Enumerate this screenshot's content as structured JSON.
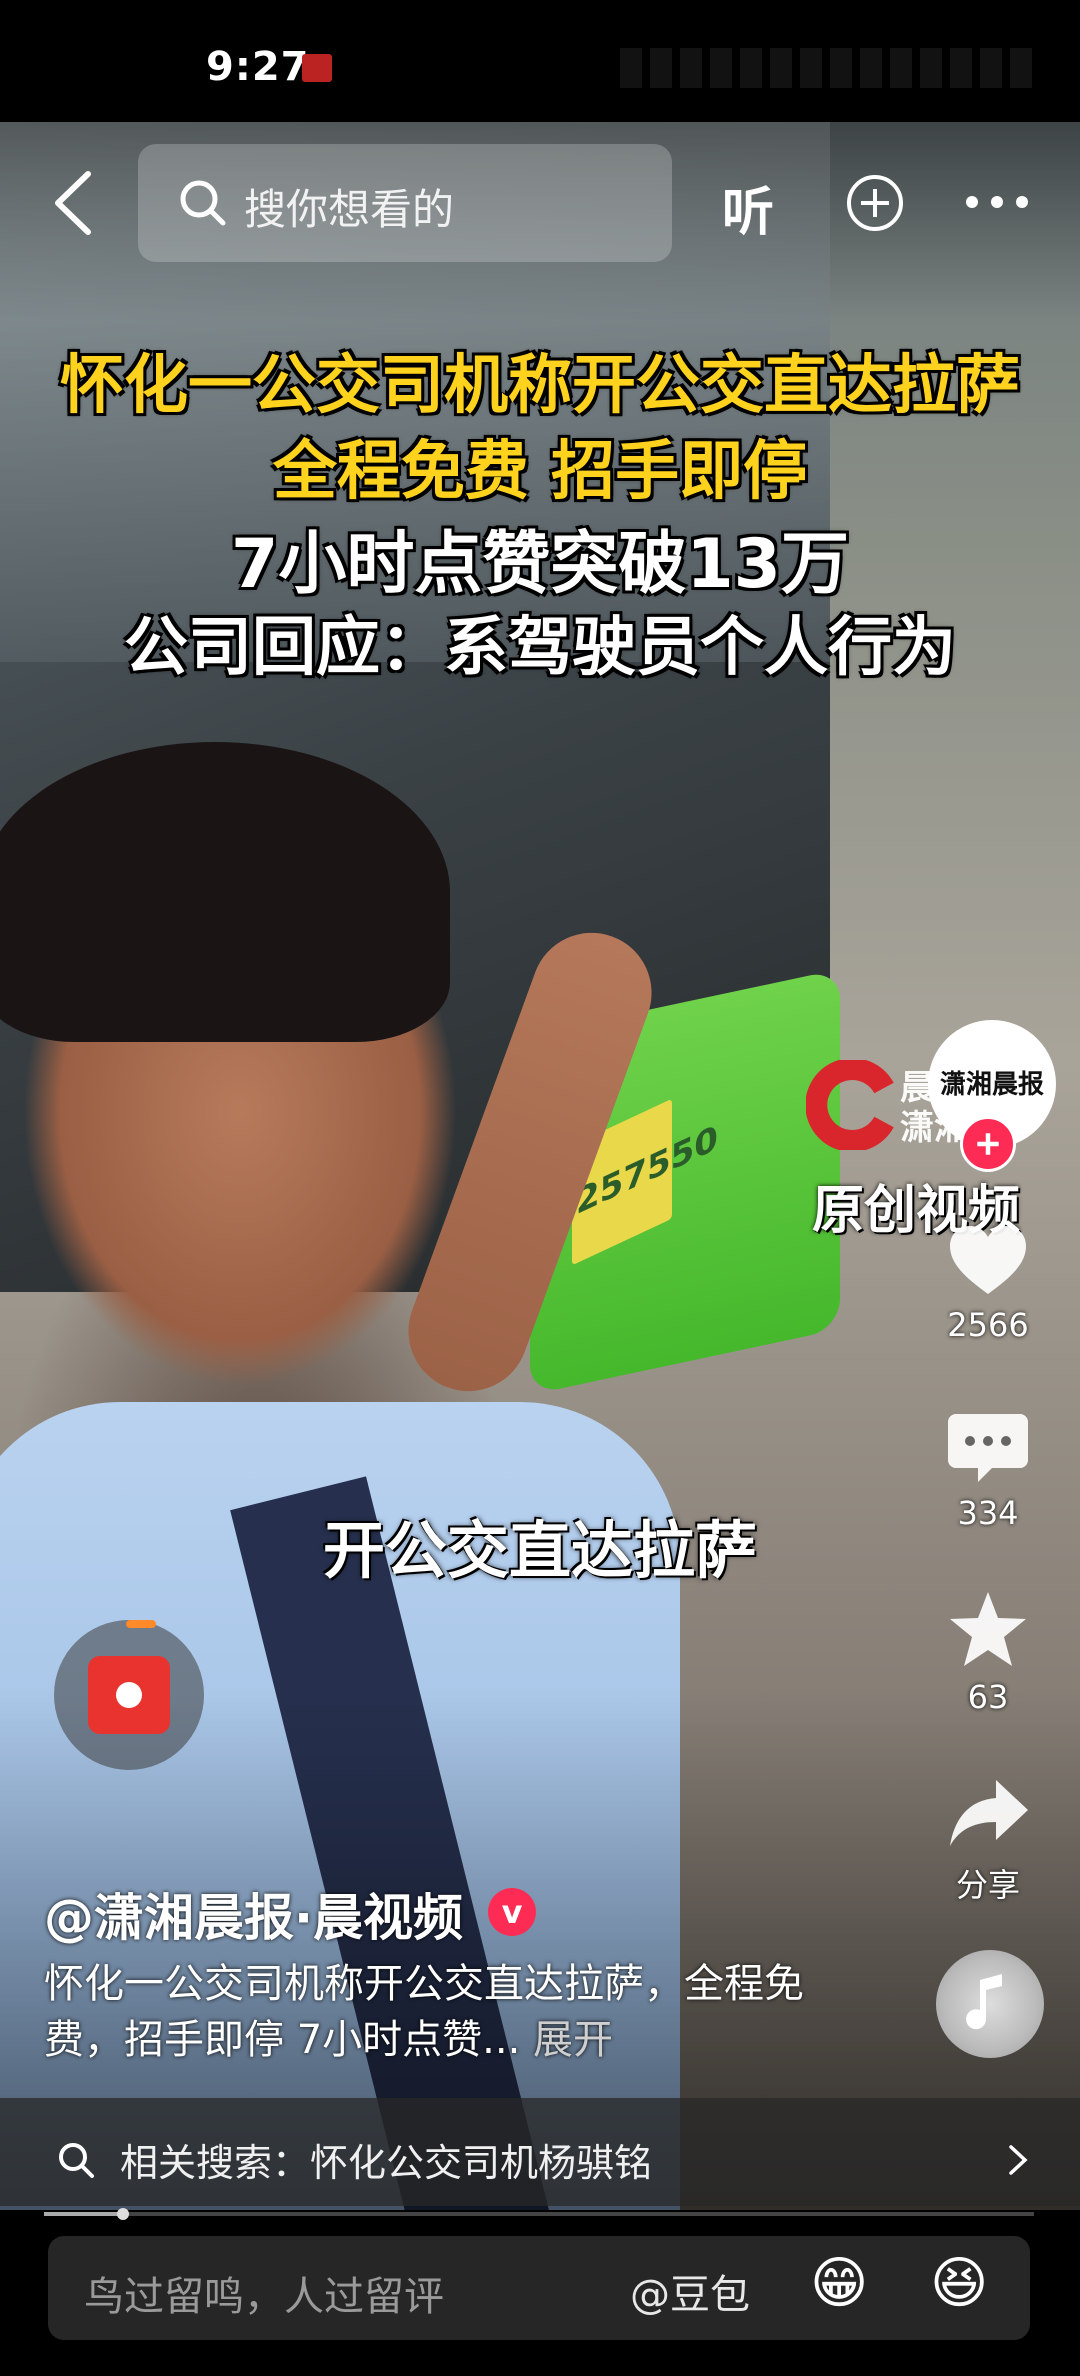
{
  "status_bar": {
    "time": "9:27"
  },
  "top_nav": {
    "search_placeholder": "搜你想看的",
    "listen_label": "听"
  },
  "video": {
    "headline_lines": [
      "怀化一公交司机称开公交直达拉萨",
      "全程免费 招手即停",
      "7小时点赞突破13万",
      "公司回应：系驾驶员个人行为"
    ],
    "caption": "开公交直达拉萨",
    "plate": "257550",
    "watermark_lines": [
      "晨",
      "潇湘"
    ],
    "original_label": "原创视频"
  },
  "sidebar": {
    "avatar_text": "潇湘晨报",
    "likes": "2566",
    "comments": "334",
    "favorites": "63",
    "share_label": "分享"
  },
  "post": {
    "author": "@潇湘晨报·晨视频",
    "verified_mark": "v",
    "description": "怀化一公交司机称开公交直达拉萨，全程免费，招手即停 7小时点赞...",
    "expand_label": "展开"
  },
  "related_search": {
    "text": "相关搜索：怀化公交司机杨骐铭"
  },
  "playback": {
    "progress": 0.08
  },
  "comment_bar": {
    "placeholder": "鸟过留鸣，人过留评",
    "mention": "@豆包",
    "emoji_1": "😁",
    "emoji_2": "😆"
  },
  "colors": {
    "accent_red": "#fe2c55",
    "headline_yellow": "#ffd21e"
  },
  "icons": [
    "back-icon",
    "search-icon",
    "add-icon",
    "more-icon",
    "heart-icon",
    "comment-icon",
    "star-icon",
    "share-icon",
    "music-icon",
    "chevron-right-icon",
    "red-packet-icon"
  ]
}
